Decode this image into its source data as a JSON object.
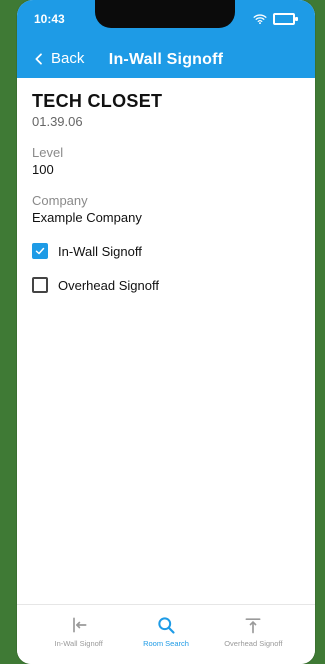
{
  "status_bar": {
    "time": "10:43"
  },
  "header": {
    "back_label": "Back",
    "title": "In-Wall Signoff"
  },
  "room": {
    "name": "TECH CLOSET",
    "number": "01.39.06"
  },
  "fields": {
    "level_label": "Level",
    "level_value": "100",
    "company_label": "Company",
    "company_value": "Example Company"
  },
  "signoffs": [
    {
      "label": "In-Wall Signoff",
      "checked": true
    },
    {
      "label": "Overhead Signoff",
      "checked": false
    }
  ],
  "tabs": [
    {
      "label": "In-Wall Signoff",
      "icon": "arrow-left-bar-icon",
      "active": false
    },
    {
      "label": "Room Search",
      "icon": "search-icon",
      "active": true
    },
    {
      "label": "Overhead Signoff",
      "icon": "arrow-up-bar-icon",
      "active": false
    }
  ],
  "colors": {
    "accent": "#1e9be6",
    "background": "#3f7a35"
  }
}
